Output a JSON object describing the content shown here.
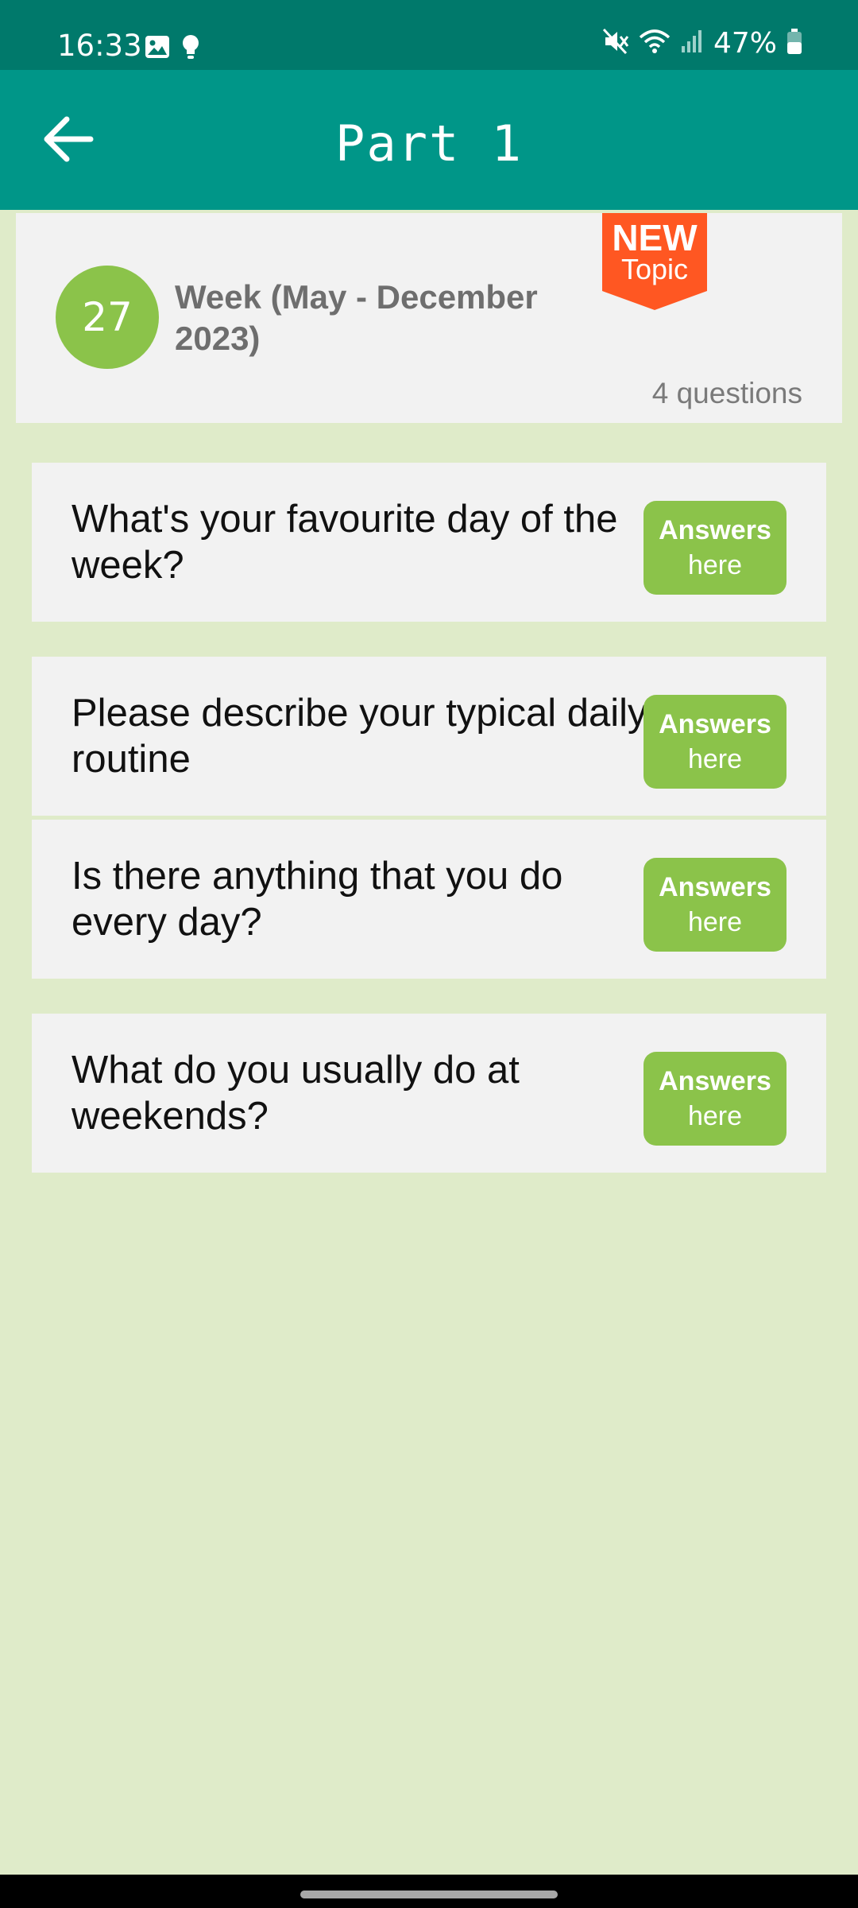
{
  "status_bar": {
    "time": "16:33",
    "battery": "47%",
    "icons": [
      "image-icon",
      "bulb-icon",
      "mute-icon",
      "wifi-icon",
      "signal-icon",
      "battery-icon"
    ]
  },
  "app_bar": {
    "title": "Part 1",
    "back_icon": "arrow-left-icon"
  },
  "topic": {
    "number": "27",
    "title": "Week (May - December 2023)",
    "badge_line1": "NEW",
    "badge_line2": "Topic",
    "question_count": "4 questions"
  },
  "questions": [
    {
      "text": "What's your favourite day of the week?",
      "button_line1": "Answers",
      "button_line2": "here"
    },
    {
      "text": "Please describe your typical daily routine",
      "button_line1": "Answers",
      "button_line2": "here"
    },
    {
      "text": "Is there anything that you do every day?",
      "button_line1": "Answers",
      "button_line2": "here"
    },
    {
      "text": "What do you usually do at weekends?",
      "button_line1": "Answers",
      "button_line2": "here"
    }
  ],
  "colors": {
    "status_bar": "#00796b",
    "app_bar": "#009688",
    "accent_green": "#8bc34a",
    "badge_orange": "#ff5722",
    "background": "#dfebc9",
    "card": "#f2f2f2"
  }
}
